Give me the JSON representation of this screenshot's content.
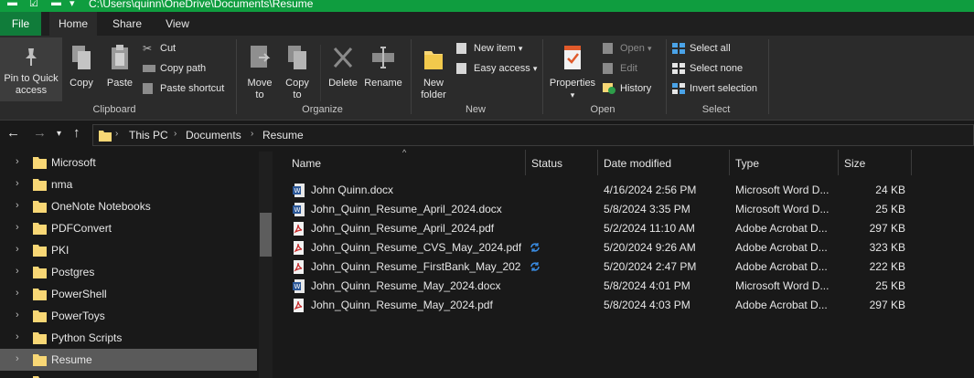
{
  "window": {
    "path": "C:\\Users\\quinn\\OneDrive\\Documents\\Resume"
  },
  "ribbon_tabs": [
    "File",
    "Home",
    "Share",
    "View"
  ],
  "ribbon": {
    "clipboard": {
      "pin_label_1": "Pin to Quick",
      "pin_label_2": "access",
      "copy": "Copy",
      "paste": "Paste",
      "cut": "Cut",
      "copy_path": "Copy path",
      "paste_shortcut": "Paste shortcut",
      "group": "Clipboard"
    },
    "organize": {
      "move_to_1": "Move",
      "move_to_2": "to",
      "copy_to_1": "Copy",
      "copy_to_2": "to",
      "delete": "Delete",
      "rename": "Rename",
      "group": "Organize"
    },
    "new": {
      "new_folder_1": "New",
      "new_folder_2": "folder",
      "new_item": "New item",
      "easy_access": "Easy access",
      "group": "New"
    },
    "open": {
      "properties": "Properties",
      "open": "Open",
      "edit": "Edit",
      "history": "History",
      "group": "Open"
    },
    "select": {
      "select_all": "Select all",
      "select_none": "Select none",
      "invert_selection": "Invert selection",
      "group": "Select"
    }
  },
  "breadcrumb": [
    "This PC",
    "Documents",
    "Resume"
  ],
  "nav_pane": {
    "items": [
      {
        "label": "Microsoft",
        "selected": false
      },
      {
        "label": "nma",
        "selected": false
      },
      {
        "label": "OneNote Notebooks",
        "selected": false
      },
      {
        "label": "PDFConvert",
        "selected": false
      },
      {
        "label": "PKI",
        "selected": false
      },
      {
        "label": "Postgres",
        "selected": false
      },
      {
        "label": "PowerShell",
        "selected": false
      },
      {
        "label": "PowerToys",
        "selected": false
      },
      {
        "label": "Python Scripts",
        "selected": false
      },
      {
        "label": "Resume",
        "selected": true
      }
    ]
  },
  "file_list": {
    "columns": [
      "Name",
      "Status",
      "Date modified",
      "Type",
      "Size"
    ],
    "rows": [
      {
        "name": "John Quinn.docx",
        "kind": "word",
        "status": "",
        "date": "4/16/2024 2:56 PM",
        "type": "Microsoft Word D...",
        "size": "24 KB"
      },
      {
        "name": "John_Quinn_Resume_April_2024.docx",
        "kind": "word",
        "status": "",
        "date": "5/8/2024 3:35 PM",
        "type": "Microsoft Word D...",
        "size": "25 KB"
      },
      {
        "name": "John_Quinn_Resume_April_2024.pdf",
        "kind": "pdf",
        "status": "",
        "date": "5/2/2024 11:10 AM",
        "type": "Adobe Acrobat D...",
        "size": "297 KB"
      },
      {
        "name": "John_Quinn_Resume_CVS_May_2024.pdf",
        "kind": "pdf",
        "status": "sync",
        "date": "5/20/2024 9:26 AM",
        "type": "Adobe Acrobat D...",
        "size": "323 KB"
      },
      {
        "name": "John_Quinn_Resume_FirstBank_May_202...",
        "kind": "pdf",
        "status": "sync",
        "date": "5/20/2024 2:47 PM",
        "type": "Adobe Acrobat D...",
        "size": "222 KB"
      },
      {
        "name": "John_Quinn_Resume_May_2024.docx",
        "kind": "word",
        "status": "",
        "date": "5/8/2024 4:01 PM",
        "type": "Microsoft Word D...",
        "size": "25 KB"
      },
      {
        "name": "John_Quinn_Resume_May_2024.pdf",
        "kind": "pdf",
        "status": "",
        "date": "5/8/2024 4:03 PM",
        "type": "Adobe Acrobat D...",
        "size": "297 KB"
      }
    ]
  },
  "colors": {
    "titlebar": "#0f9d3f",
    "file_tab": "#107c3a",
    "ribbon_bg": "#2b2b2b",
    "window_bg": "#191919",
    "selection": "#5a5a5a",
    "folder": "#f8d775",
    "word": "#2b5797",
    "pdf": "#c62828",
    "sync": "#3a8ee6"
  }
}
